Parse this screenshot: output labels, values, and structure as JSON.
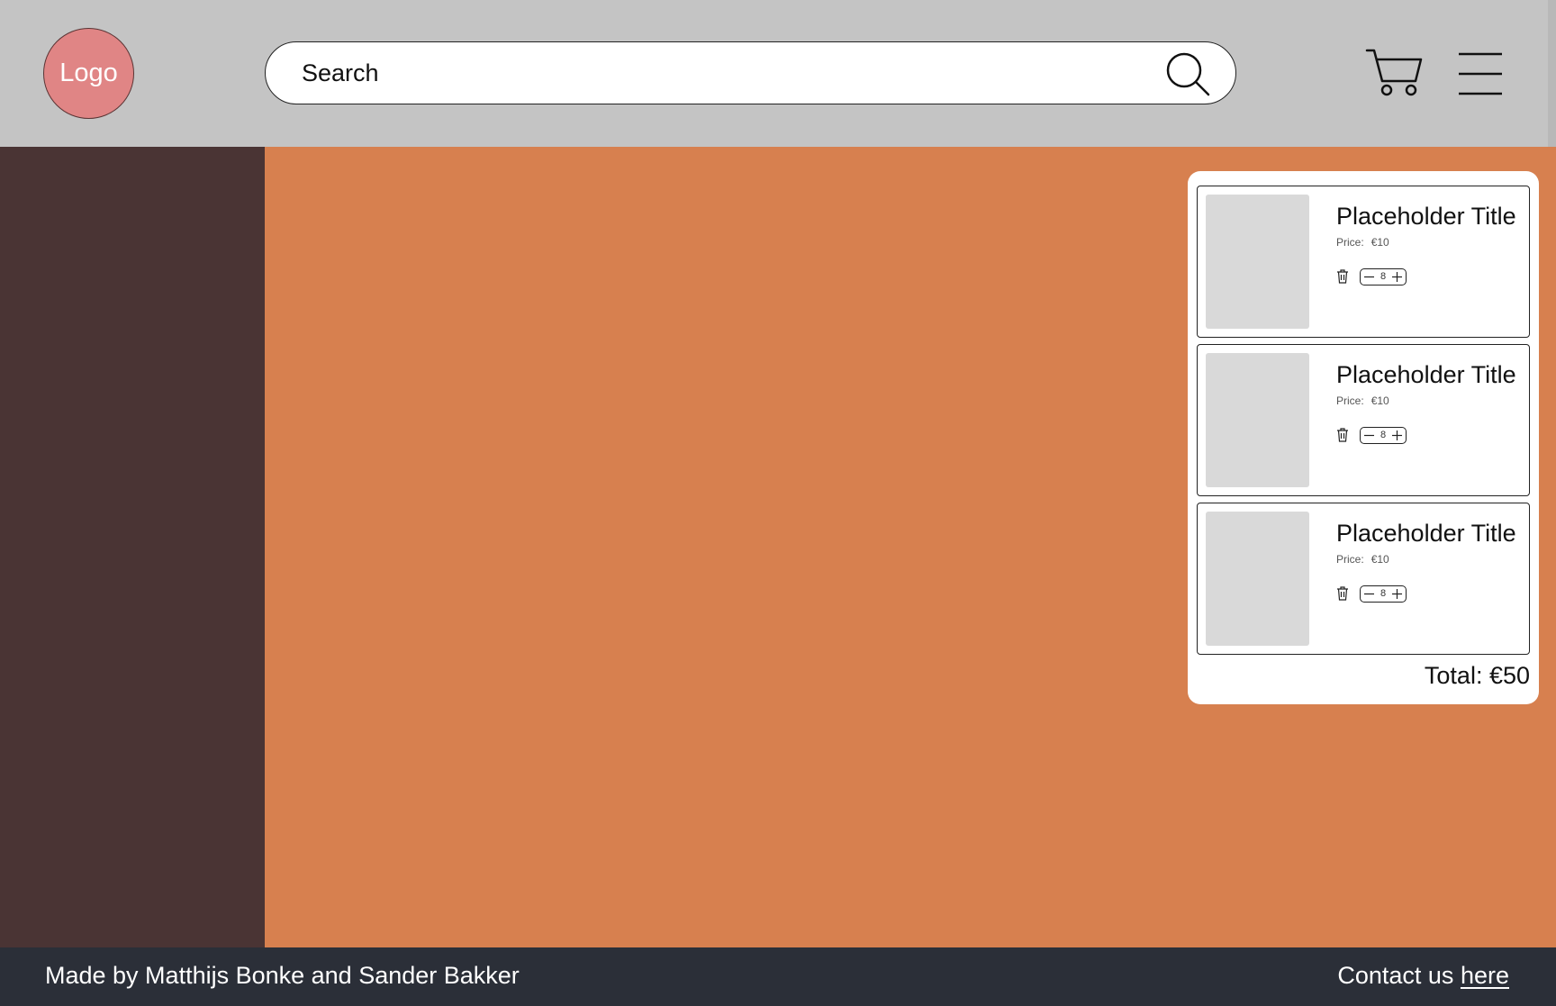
{
  "colors": {
    "header_bg": "#c4c4c4",
    "sidebar_bg": "#4a3434",
    "main_bg": "#d7804f",
    "footer_bg": "#2b2f38",
    "logo_bg": "#e08585",
    "image_placeholder": "#d9d9d9"
  },
  "header": {
    "logo_text": "Logo",
    "search": {
      "placeholder": "Search",
      "value": "",
      "icon": "search-icon"
    },
    "cart_icon": "cart-icon",
    "menu_icon": "hamburger-menu-icon"
  },
  "cart": {
    "items": [
      {
        "title": "Placeholder Title",
        "price_label": "Price:",
        "price": "€10",
        "quantity": "8"
      },
      {
        "title": "Placeholder Title",
        "price_label": "Price:",
        "price": "€10",
        "quantity": "8"
      },
      {
        "title": "Placeholder Title",
        "price_label": "Price:",
        "price": "€10",
        "quantity": "8"
      }
    ],
    "total": "Total: €50"
  },
  "footer": {
    "credit": "Made by Matthijs Bonke and Sander Bakker",
    "contact_prefix": "Contact us",
    "contact_link": "here"
  }
}
